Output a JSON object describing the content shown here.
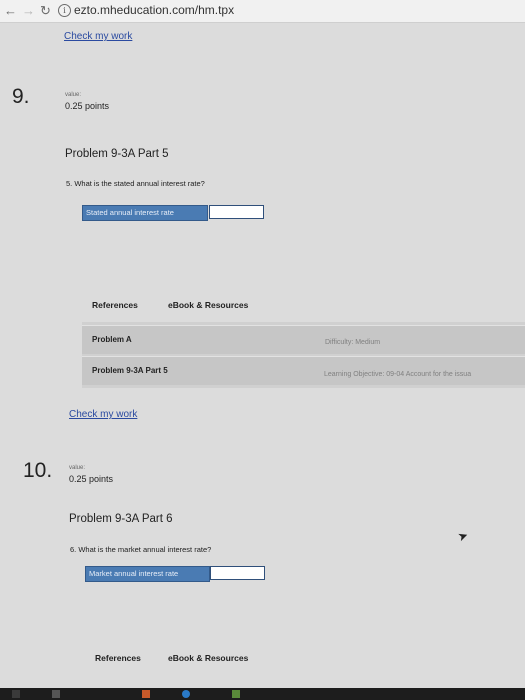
{
  "browser": {
    "url": "ezto.mheducation.com/hm.tpx"
  },
  "check_link": "Check my work",
  "questions": [
    {
      "number": "9.",
      "value_label": "value:",
      "points": "0.25 points",
      "title": "Problem 9-3A Part 5",
      "question": "5.  What is the stated annual interest rate?",
      "field_label": "Stated annual interest rate",
      "field_value": "",
      "tabs": {
        "references": "References",
        "ebook": "eBook & Resources"
      },
      "ref_rows": [
        "Problem A",
        "Problem 9-3A Part 5"
      ],
      "difficulty": "Difficulty: Medium",
      "objective": "Learning Objective: 09-04 Account for the issua",
      "check_link": "Check my work"
    },
    {
      "number": "10.",
      "value_label": "value:",
      "points": "0.25 points",
      "title": "Problem 9-3A Part 6",
      "question": "6.  What is the market annual interest rate?",
      "field_label": "Market annual interest rate",
      "field_value": "",
      "tabs": {
        "references": "References",
        "ebook": "eBook & Resources"
      }
    }
  ]
}
